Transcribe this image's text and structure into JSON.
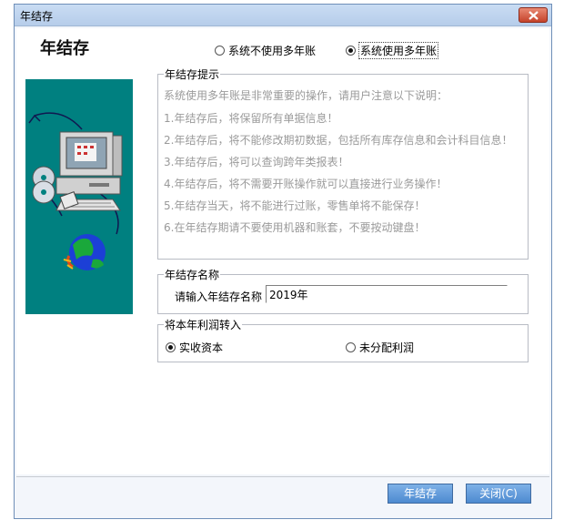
{
  "window": {
    "title": "年结存",
    "heading": "年结存"
  },
  "mode": {
    "option_single": "系统不使用多年账",
    "option_multi": "系统使用多年账",
    "selected": "multi"
  },
  "tips": {
    "legend": "年结存提示",
    "lines": [
      "系统使用多年账是非常重要的操作，请用户注意以下说明：",
      "1.年结存后，将保留所有单据信息！",
      "2.年结存后，将不能修改期初数据，包括所有库存信息和会计科目信息！",
      "3.年结存后，将可以查询跨年类报表！",
      "4.年结存后，将不需要开账操作就可以直接进行业务操作！",
      "5.年结存当天，将不能进行过账，零售单将不能保存！",
      "6.在年结存期请不要使用机器和账套，不要按动键盘！"
    ]
  },
  "name_group": {
    "legend": "年结存名称",
    "label": "请输入年结存名称",
    "value": "2019年"
  },
  "profit_group": {
    "legend": "将本年利润转入",
    "option_capital": "实收资本",
    "option_undistributed": "未分配利润",
    "selected": "capital"
  },
  "buttons": {
    "confirm": "年结存",
    "close": "关闭(C)"
  },
  "icons": {
    "illustration": "computer-cd-globe-illustration",
    "close": "close-icon"
  },
  "colors": {
    "illustration_bg": "#008080",
    "button_blue": "#5b93d3",
    "titlebar": "#c2d7f0",
    "close_red": "#d0533b"
  }
}
